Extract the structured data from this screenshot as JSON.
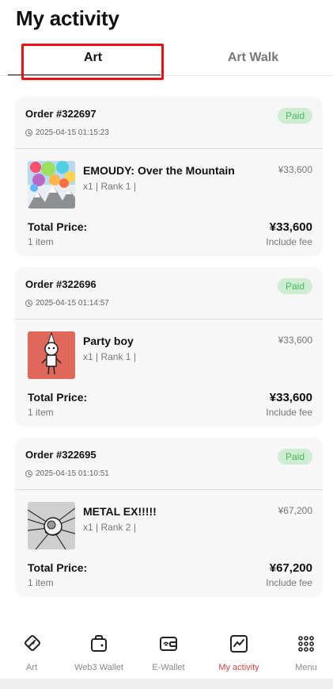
{
  "header": {
    "title": "My activity"
  },
  "tabs": [
    {
      "label": "Art",
      "active": true
    },
    {
      "label": "Art Walk",
      "active": false
    }
  ],
  "orders": [
    {
      "number": "Order #322697",
      "time": "2025-04-15 01:15:23",
      "status": "Paid",
      "item": {
        "title": "EMOUDY: Over the Mountain",
        "meta": "x1 | Rank 1 |",
        "price": "¥33,600",
        "thumb_icon": "emoudy-artwork"
      },
      "total": {
        "label": "Total Price:",
        "items": "1 item",
        "price": "¥33,600",
        "fee_note": "Include fee"
      }
    },
    {
      "number": "Order #322696",
      "time": "2025-04-15 01:14:57",
      "status": "Paid",
      "item": {
        "title": "Party boy",
        "meta": "x1 | Rank 1 |",
        "price": "¥33,600",
        "thumb_icon": "party-boy-artwork"
      },
      "total": {
        "label": "Total Price:",
        "items": "1 item",
        "price": "¥33,600",
        "fee_note": "Include fee"
      }
    },
    {
      "number": "Order #322695",
      "time": "2025-04-15 01:10:51",
      "status": "Paid",
      "item": {
        "title": "METAL EX!!!!!",
        "meta": "x1 | Rank 2 |",
        "price": "¥67,200",
        "thumb_icon": "metal-ex-artwork"
      },
      "total": {
        "label": "Total Price:",
        "items": "1 item",
        "price": "¥67,200",
        "fee_note": "Include fee"
      }
    }
  ],
  "bottom_nav": [
    {
      "label": "Art",
      "icon": "art-icon",
      "active": false
    },
    {
      "label": "Web3 Wallet",
      "icon": "web3-wallet-icon",
      "active": false
    },
    {
      "label": "E-Wallet",
      "icon": "e-wallet-icon",
      "active": false
    },
    {
      "label": "My activity",
      "icon": "activity-chart-icon",
      "active": true
    },
    {
      "label": "Menu",
      "icon": "menu-grid-icon",
      "active": false
    }
  ],
  "colors": {
    "accent_active": "#d64545",
    "paid_badge_bg": "#cdeed2",
    "paid_badge_text": "#4fb45f",
    "highlight_box": "#ee1111"
  }
}
